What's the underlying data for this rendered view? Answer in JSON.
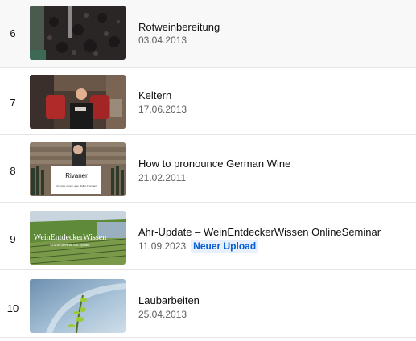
{
  "videos": [
    {
      "index": "6",
      "title": "Rotweinbereitung",
      "date": "03.04.2013"
    },
    {
      "index": "7",
      "title": "Keltern",
      "date": "17.06.2013"
    },
    {
      "index": "8",
      "title": "How to pronounce German Wine",
      "date": "21.02.2011",
      "thumb_sign_title": "Rivaner",
      "thumb_sign_sub": "(A grape variety, also Müller-Thurgau)"
    },
    {
      "index": "9",
      "title": "Ahr-Update – WeinEntdeckerWissen OnlineSeminar",
      "date": "11.09.2023",
      "badge": "Neuer Upload",
      "thumb_caption": "WeinEntdeckerWissen",
      "thumb_caption_sub": "Online-Seminar Ahr-Update"
    },
    {
      "index": "10",
      "title": "Laubarbeiten",
      "date": "25.04.2013"
    }
  ],
  "colors": {
    "badge_text": "#065fd4",
    "badge_bg": "#e8f0fe",
    "meta_text": "#606060",
    "divider": "#e5e5e5"
  }
}
